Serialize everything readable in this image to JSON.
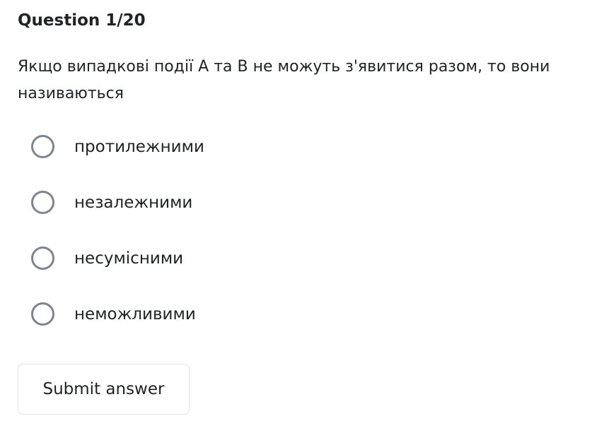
{
  "quiz": {
    "counter": "Question 1/20",
    "question": "Якщо випадкові події A та B не можуть з'явитися разом, то вони називаються",
    "options": [
      {
        "label": "протилежними"
      },
      {
        "label": "незалежними"
      },
      {
        "label": "несумісними"
      },
      {
        "label": "неможливими"
      }
    ],
    "submit_label": "Submit answer"
  }
}
